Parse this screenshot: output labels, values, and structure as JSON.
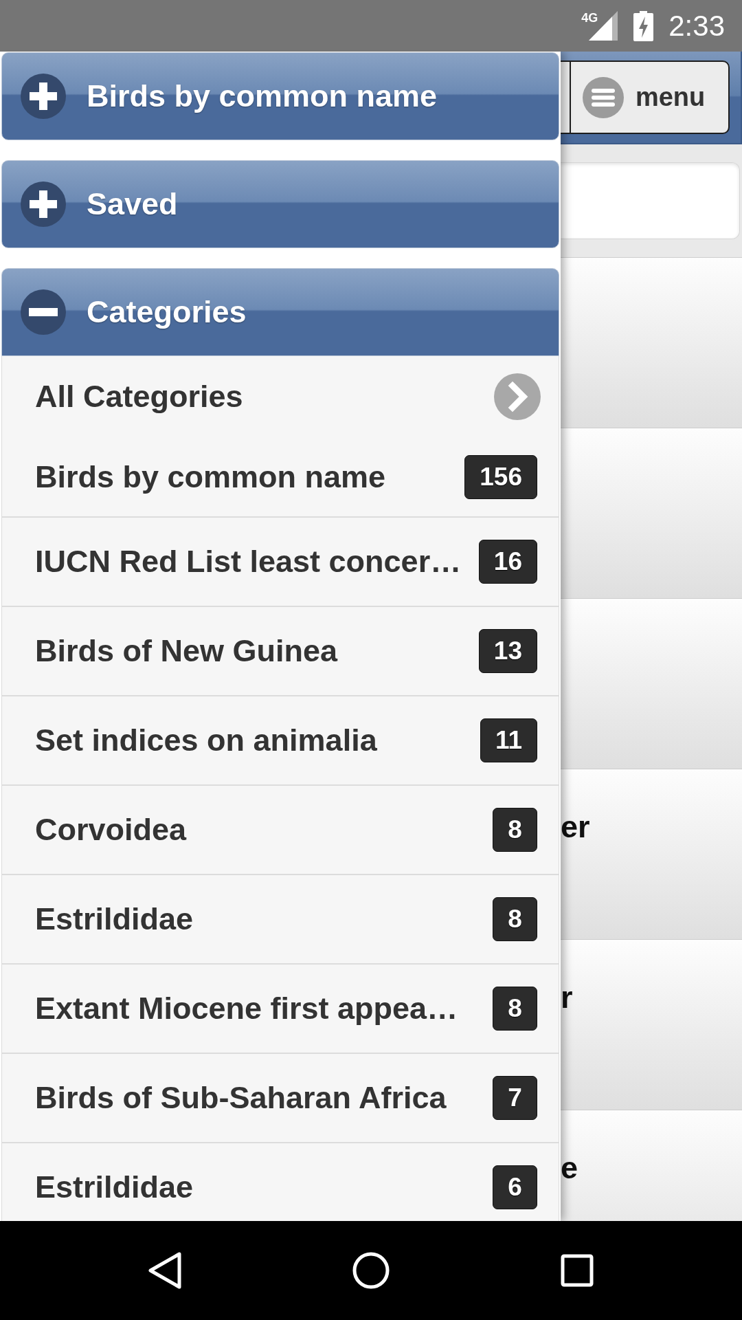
{
  "status_bar": {
    "network": "4G",
    "time": "2:33"
  },
  "drawer": {
    "sections": [
      {
        "title": "Birds by common name",
        "expanded": false
      },
      {
        "title": "Saved",
        "expanded": false
      },
      {
        "title": "Categories",
        "expanded": true,
        "link": "All Categories",
        "items": [
          {
            "label": "Birds by common name",
            "count": "156"
          },
          {
            "label": "IUCN Red List least concer…",
            "count": "16"
          },
          {
            "label": "Birds of New Guinea",
            "count": "13"
          },
          {
            "label": "Set indices on animalia",
            "count": "11"
          },
          {
            "label": "Corvoidea",
            "count": "8"
          },
          {
            "label": "Estrildidae",
            "count": "8"
          },
          {
            "label": "Extant Miocene first appea…",
            "count": "8"
          },
          {
            "label": "Birds of Sub-Saharan Africa",
            "count": "7"
          },
          {
            "label": "Estrildidae",
            "count": "6"
          }
        ]
      }
    ]
  },
  "page": {
    "menu_button": "menu",
    "list_items": [
      {
        "kind": "blank"
      },
      {
        "kind": "blank"
      },
      {
        "kind": "blank"
      },
      {
        "kind": "text",
        "text": "er"
      },
      {
        "kind": "text",
        "text": "r"
      },
      {
        "kind": "text",
        "text": "e"
      }
    ]
  }
}
